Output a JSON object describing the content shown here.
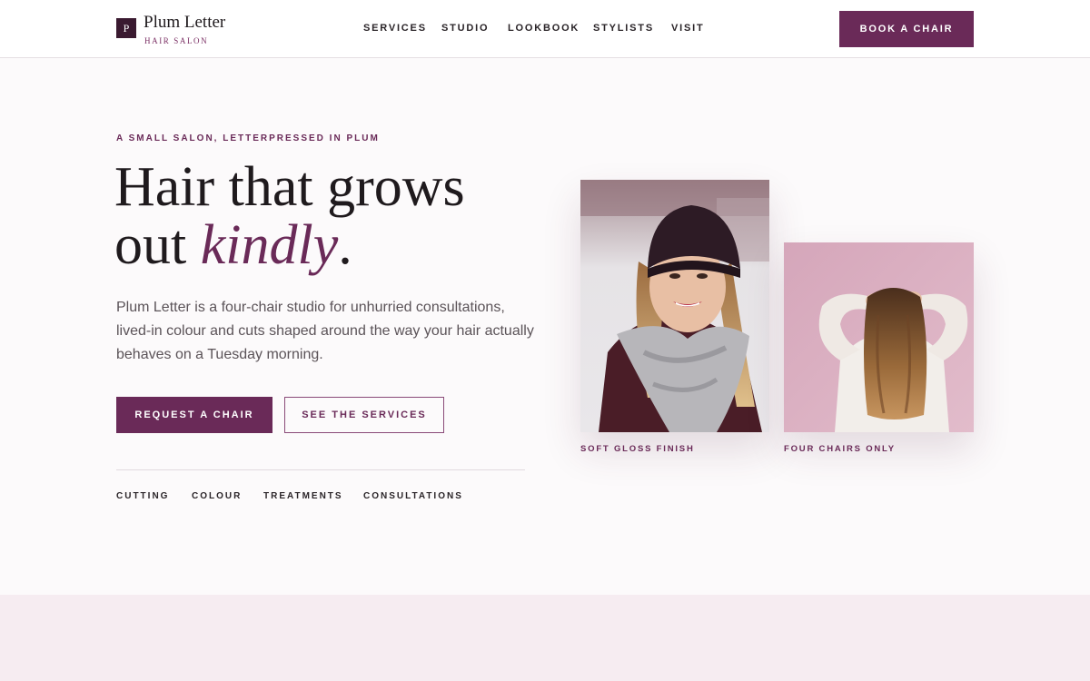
{
  "brand": {
    "mark": "P",
    "name": "Plum Letter",
    "sub": "HAIR SALON"
  },
  "nav": {
    "items": [
      "SERVICES",
      "STUDIO",
      "LOOKBOOK",
      "STYLISTS",
      "VISIT"
    ],
    "cta": "BOOK A CHAIR"
  },
  "hero": {
    "eyebrow": "A SMALL SALON, LETTERPRESSED IN PLUM",
    "headline_line1": "Hair that grows",
    "headline_pre": "out ",
    "headline_em": "kindly",
    "headline_post": ".",
    "lede": "Plum Letter is a four-chair studio for unhurried consultations, lived-in colour and cuts shaped around the way your hair actually behaves on a Tuesday morning.",
    "primary_cta": "REQUEST A CHAIR",
    "secondary_cta": "SEE THE SERVICES",
    "tags": [
      "CUTTING",
      "COLOUR",
      "TREATMENTS",
      "CONSULTATIONS"
    ]
  },
  "photos": [
    {
      "caption": "SOFT GLOSS FINISH"
    },
    {
      "caption": "FOUR CHAIRS ONLY"
    }
  ],
  "colors": {
    "accent": "#6a2a58",
    "background": "#fcfafb",
    "band": "#f6ecf1"
  }
}
